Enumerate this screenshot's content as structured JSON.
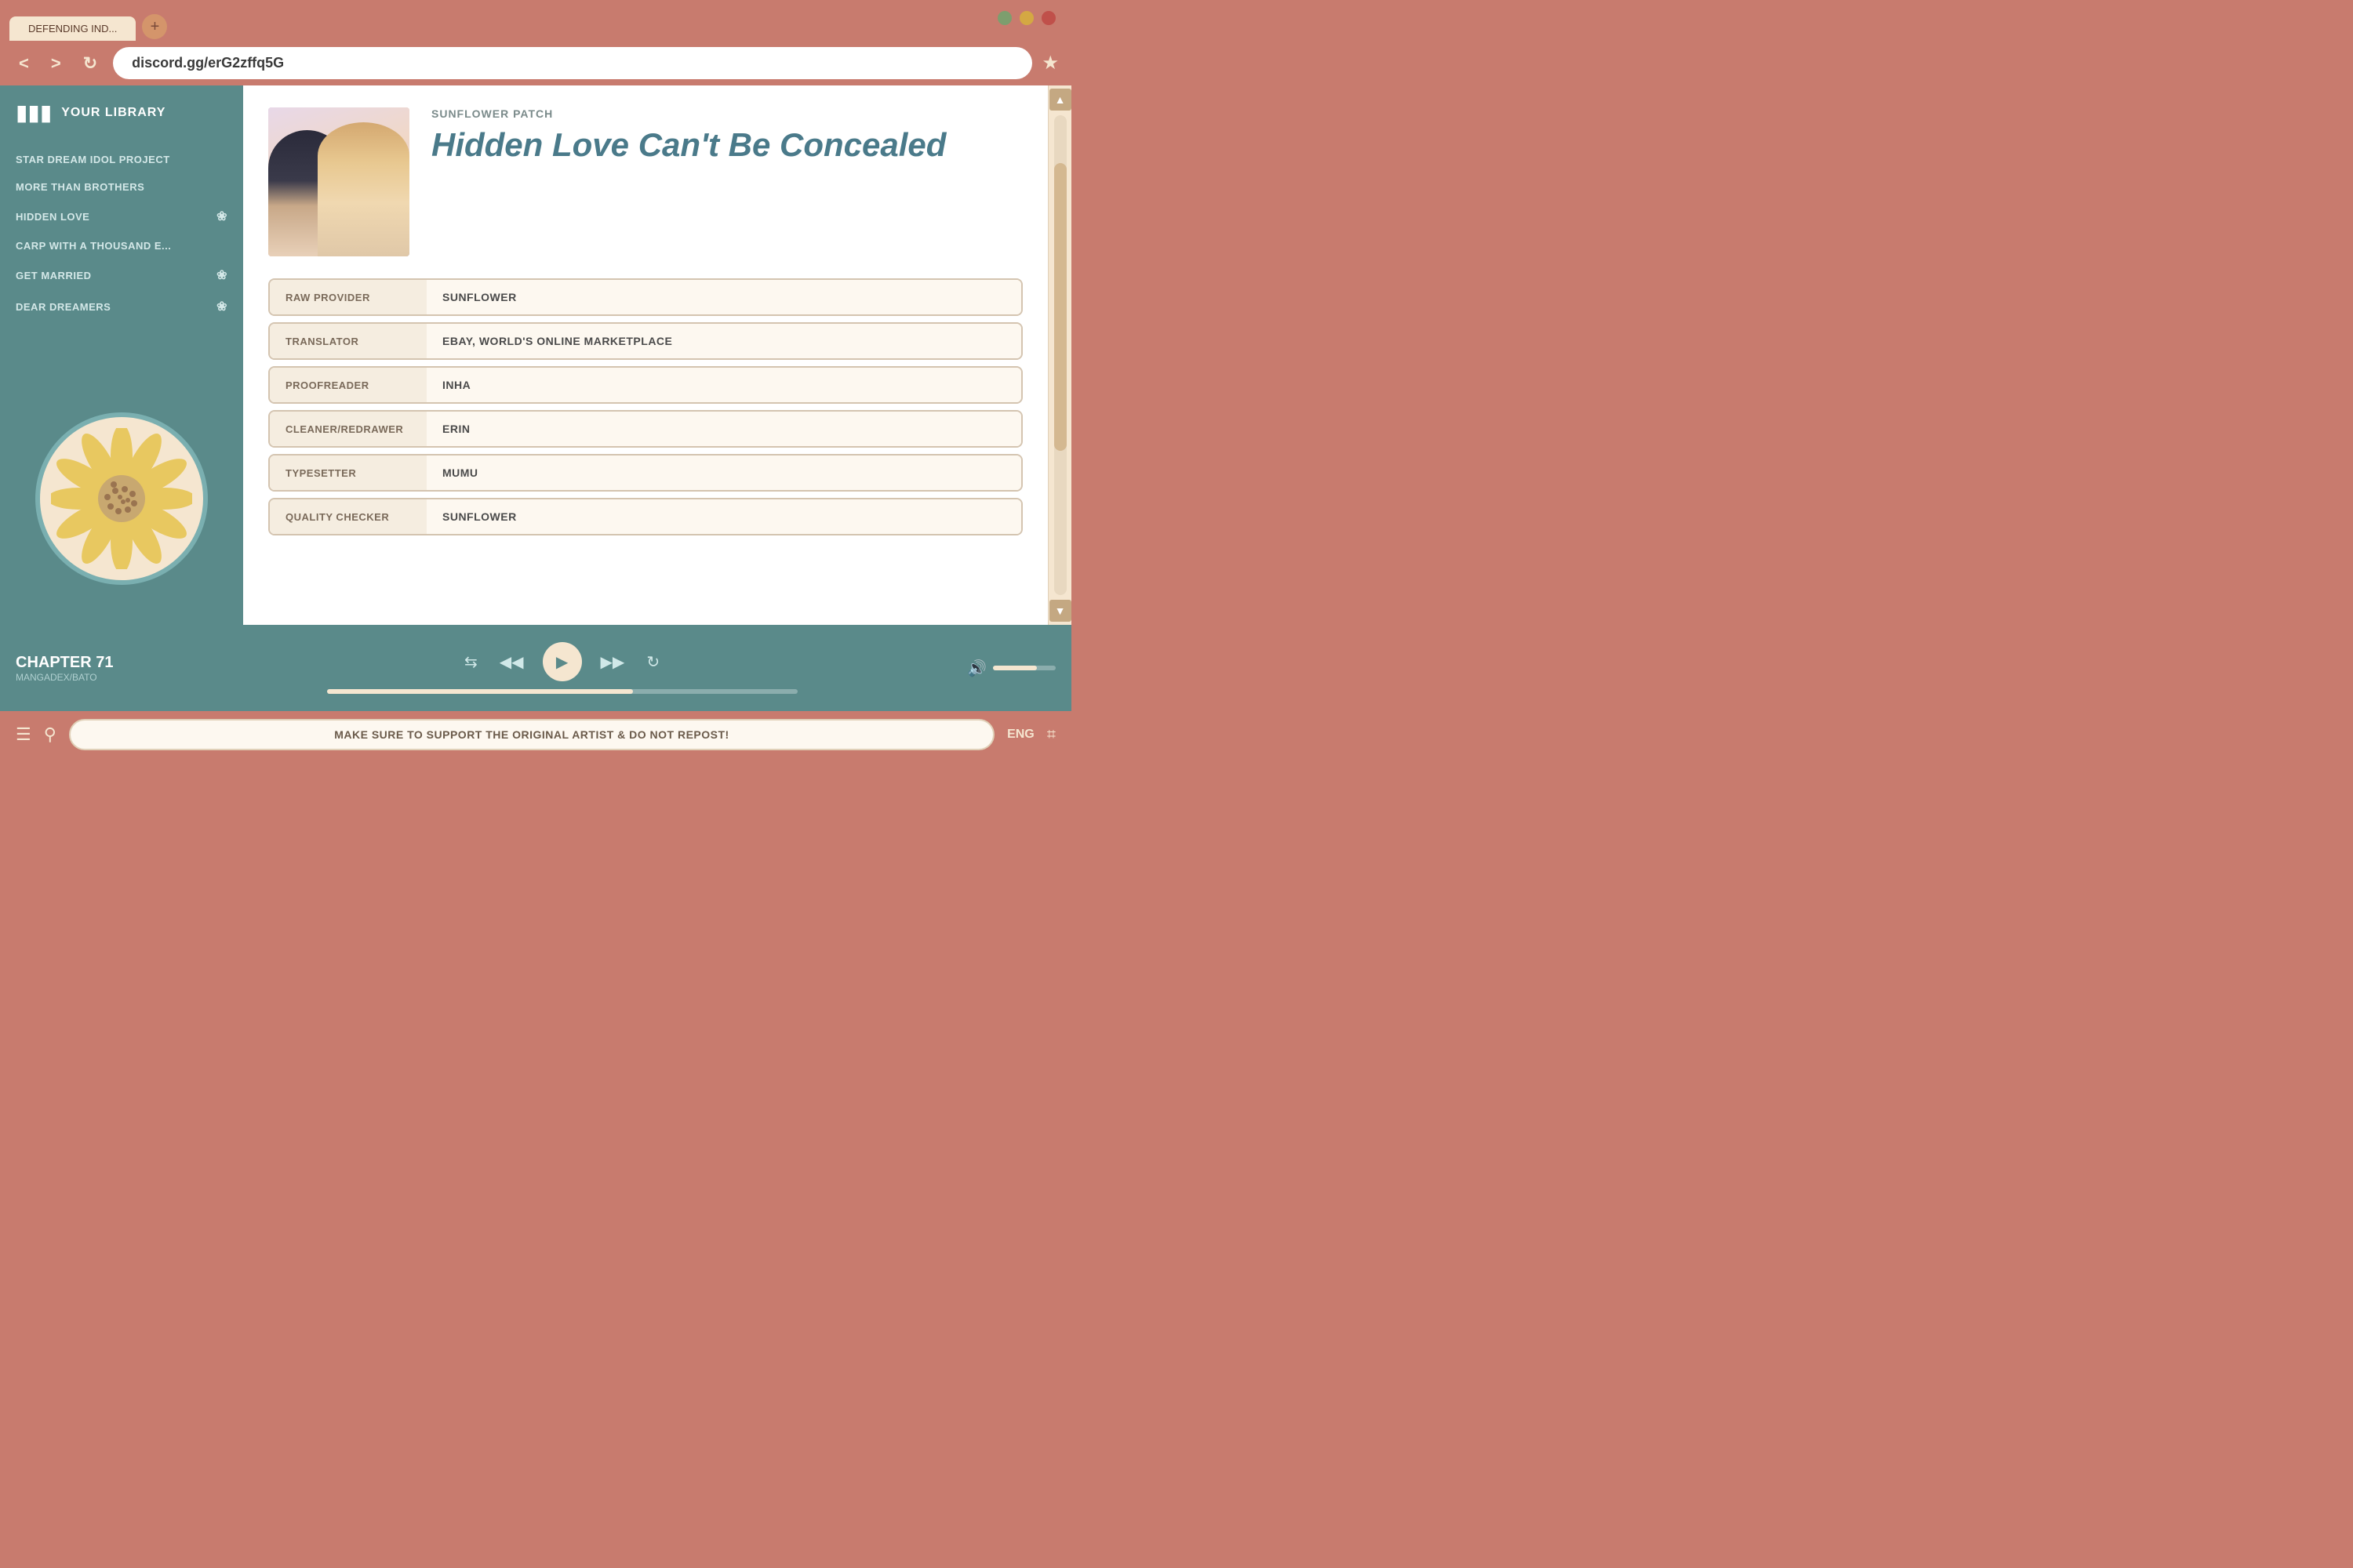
{
  "browser": {
    "tab_label": "DEFENDING IND...",
    "new_tab_icon": "+",
    "address": "discord.gg/erG2zffq5G",
    "window_controls": [
      "green",
      "yellow",
      "red"
    ]
  },
  "sidebar": {
    "title": "YOUR LIBRARY",
    "items": [
      {
        "label": "STAR DREAM IDOL PROJECT",
        "has_icon": false
      },
      {
        "label": "MORE THAN BROTHERS",
        "has_icon": false
      },
      {
        "label": "HIDDEN LOVE",
        "has_icon": true
      },
      {
        "label": "CARP WITH A THOUSAND E...",
        "has_icon": false
      },
      {
        "label": "GET MARRIED",
        "has_icon": true
      },
      {
        "label": "DEAR DREAMERS",
        "has_icon": true
      }
    ]
  },
  "manga": {
    "publisher": "SUNFLOWER PATCH",
    "title": "Hidden Love Can't Be Concealed",
    "credits": [
      {
        "label": "RAW PROVIDER",
        "value": "SUNFLOWER"
      },
      {
        "label": "TRANSLATOR",
        "value": "EBAY, WORLD'S ONLINE MARKETPLACE"
      },
      {
        "label": "PROOFREADER",
        "value": "INHA"
      },
      {
        "label": "CLEANER/REDRAWER",
        "value": "ERIN"
      },
      {
        "label": "TYPESETTER",
        "value": "MUMU"
      },
      {
        "label": "QUALITY CHECKER",
        "value": "SUNFLOWER"
      }
    ]
  },
  "player": {
    "chapter": "CHAPTER 71",
    "source": "MANGADEX/BATO",
    "progress": 65,
    "volume": 70
  },
  "bottom_bar": {
    "notice": "MAKE SURE TO SUPPORT THE ORIGINAL ARTIST & DO NOT REPOST!",
    "language": "ENG"
  }
}
